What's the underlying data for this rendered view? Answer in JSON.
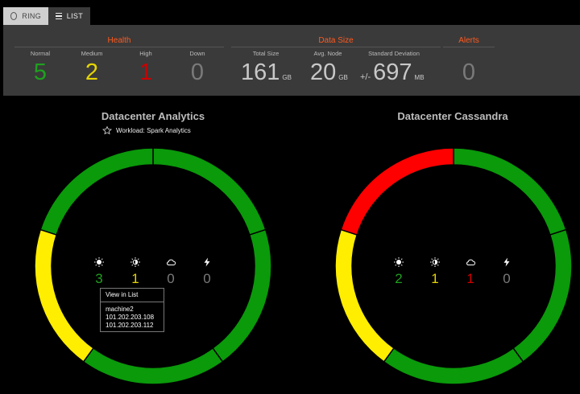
{
  "tabs": [
    {
      "label": "RING",
      "icon": "ring-icon"
    },
    {
      "label": "LIST",
      "icon": "list-icon"
    }
  ],
  "summary": {
    "health": {
      "title": "Health",
      "normal_label": "Normal",
      "normal": "5",
      "medium_label": "Medium",
      "medium": "2",
      "high_label": "High",
      "high": "1",
      "down_label": "Down",
      "down": "0"
    },
    "data_size": {
      "title": "Data Size",
      "total_label": "Total Size",
      "total": "161",
      "total_unit": "GB",
      "avg_label": "Avg. Node",
      "avg": "20",
      "avg_unit": "GB",
      "stddev_label": "Standard Deviation",
      "stddev_prefix": "+/-",
      "stddev": "697",
      "stddev_unit": "MB"
    },
    "alerts": {
      "title": "Alerts",
      "value": "0"
    }
  },
  "colors": {
    "normal": "#1fa01f",
    "medium": "#e6d400",
    "high": "#cc0000",
    "down": "#7a7a7a",
    "accent": "#ff5a1f",
    "ring_green": "#0a9a0a",
    "ring_yellow": "#ffee00",
    "ring_red": "#ff0000"
  },
  "datacenters": [
    {
      "title": "Datacenter Analytics",
      "workload": "Workload: Spark Analytics",
      "counts": {
        "normal": "3",
        "medium": "1",
        "high": "0",
        "down": "0"
      },
      "popup": {
        "header": "View in List",
        "items": [
          "machine2",
          "101.202.203.108",
          "101.202.203.112"
        ]
      },
      "segments": [
        "green",
        "green",
        "green",
        "yellow",
        "green"
      ]
    },
    {
      "title": "Datacenter Cassandra",
      "counts": {
        "normal": "2",
        "medium": "1",
        "high": "1",
        "down": "0"
      },
      "segments": [
        "green",
        "green",
        "green",
        "yellow",
        "red"
      ]
    }
  ],
  "icons": [
    "sun-full-icon",
    "sun-partial-icon",
    "cloud-icon",
    "bolt-icon"
  ]
}
